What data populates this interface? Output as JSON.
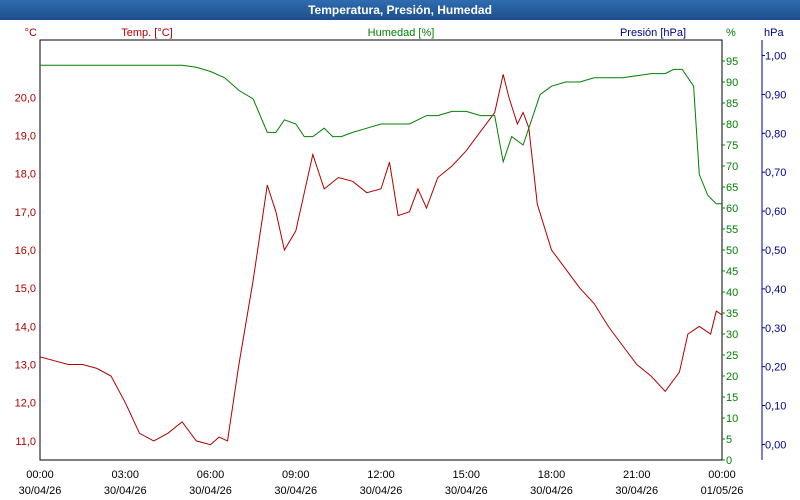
{
  "window": {
    "title": "Temperatura, Presión, Humedad"
  },
  "colors": {
    "temperature": "#b00000",
    "humidity": "#008000",
    "pressure": "#000090",
    "grid": "#000000",
    "title_bar": "#2660a3"
  },
  "chart_data": {
    "type": "line",
    "title": "Temperatura, Presión, Humedad",
    "grid": true,
    "x_ticks": [
      {
        "time": "00:00",
        "date": "30/04/26"
      },
      {
        "time": "03:00",
        "date": "30/04/26"
      },
      {
        "time": "06:00",
        "date": "30/04/26"
      },
      {
        "time": "09:00",
        "date": "30/04/26"
      },
      {
        "time": "12:00",
        "date": "30/04/26"
      },
      {
        "time": "15:00",
        "date": "30/04/26"
      },
      {
        "time": "18:00",
        "date": "30/04/26"
      },
      {
        "time": "21:00",
        "date": "30/04/26"
      },
      {
        "time": "00:00",
        "date": "01/05/26"
      }
    ],
    "axes": {
      "temperature": {
        "label": "Temp. [°C]",
        "unit": "°C",
        "ylim": [
          10.5,
          21.5
        ],
        "ticks": [
          "11,0",
          "12,0",
          "13,0",
          "14,0",
          "15,0",
          "16,0",
          "17,0",
          "18,0",
          "19,0",
          "20,0"
        ]
      },
      "humidity": {
        "label": "Humedad [%]",
        "unit": "%",
        "ylim": [
          0,
          100
        ],
        "ticks": [
          "0",
          "5",
          "10",
          "15",
          "20",
          "25",
          "30",
          "35",
          "40",
          "45",
          "50",
          "55",
          "60",
          "65",
          "70",
          "75",
          "80",
          "85",
          "90",
          "95"
        ]
      },
      "pressure": {
        "label": "Presión [hPa]",
        "unit": "hPa",
        "ylim": [
          -0.04,
          1.04
        ],
        "ticks": [
          "0,00",
          "0,10",
          "0,20",
          "0,30",
          "0,40",
          "0,50",
          "0,60",
          "0,70",
          "0,80",
          "0,90",
          "1,00"
        ]
      }
    },
    "series": [
      {
        "name": "Temp. [°C]",
        "axis": "temperature",
        "x_hours": [
          0,
          0.5,
          1,
          1.5,
          2,
          2.5,
          3,
          3.5,
          4,
          4.5,
          5,
          5.5,
          6,
          6.3,
          6.6,
          7,
          7.5,
          8,
          8.3,
          8.6,
          9,
          9.3,
          9.6,
          10,
          10.5,
          11,
          11.5,
          12,
          12.3,
          12.6,
          13,
          13.3,
          13.6,
          14,
          14.5,
          15,
          15.5,
          16,
          16.3,
          16.5,
          16.8,
          17,
          17.2,
          17.5,
          18,
          18.5,
          19,
          19.5,
          20,
          20.5,
          21,
          21.5,
          22,
          22.5,
          22.8,
          23.2,
          23.6,
          23.8,
          24
        ],
        "y": [
          13.2,
          13.1,
          13.0,
          13.0,
          12.9,
          12.7,
          12.0,
          11.2,
          11.0,
          11.2,
          11.5,
          11.0,
          10.9,
          11.1,
          11.0,
          13.0,
          15.2,
          17.7,
          17.0,
          16.0,
          16.5,
          17.5,
          18.5,
          17.6,
          17.9,
          17.8,
          17.5,
          17.6,
          18.3,
          16.9,
          17.0,
          17.6,
          17.1,
          17.9,
          18.2,
          18.6,
          19.1,
          19.6,
          20.6,
          20.0,
          19.3,
          19.6,
          19.2,
          17.2,
          16.0,
          15.5,
          15.0,
          14.6,
          14.0,
          13.5,
          13.0,
          12.7,
          12.3,
          12.8,
          13.8,
          14.0,
          13.8,
          14.4,
          14.3
        ]
      },
      {
        "name": "Humedad [%]",
        "axis": "humidity",
        "x_hours": [
          0,
          0.5,
          1,
          1.5,
          2,
          2.5,
          3,
          3.5,
          4,
          4.5,
          5,
          5.5,
          6,
          6.5,
          7,
          7.5,
          8,
          8.3,
          8.6,
          9,
          9.3,
          9.6,
          10,
          10.3,
          10.6,
          11,
          11.5,
          12,
          12.3,
          12.6,
          13,
          13.3,
          13.6,
          14,
          14.5,
          15,
          15.5,
          16,
          16.3,
          16.6,
          17,
          17.3,
          17.6,
          18,
          18.5,
          19,
          19.5,
          20,
          20.5,
          21,
          21.5,
          22,
          22.3,
          22.6,
          23,
          23.2,
          23.5,
          23.8,
          24
        ],
        "y": [
          94,
          94,
          94,
          94,
          94,
          94,
          94,
          94,
          94,
          94,
          94,
          93.5,
          92.5,
          91,
          88,
          86,
          78,
          78,
          81,
          80,
          77,
          77,
          79,
          77,
          77,
          78,
          79,
          80,
          80,
          80,
          80,
          81,
          82,
          82,
          83,
          83,
          82,
          82,
          71,
          77,
          75,
          81,
          87,
          89,
          90,
          90,
          91,
          91,
          91,
          91.5,
          92,
          92,
          93,
          93,
          89,
          68,
          63,
          61,
          61
        ]
      },
      {
        "name": "Presión [hPa]",
        "axis": "pressure",
        "x_hours": [],
        "y": []
      }
    ]
  }
}
